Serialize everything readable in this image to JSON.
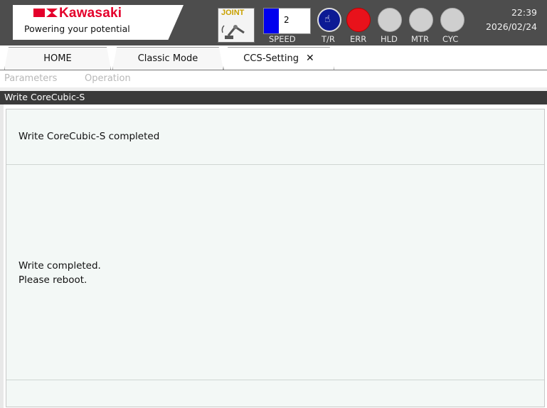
{
  "header": {
    "brand": "Kawasaki",
    "tagline": "Powering your potential",
    "joint_label": "JOINT",
    "speed_value": "2",
    "labels": {
      "speed": "SPEED",
      "tr": "T/R",
      "err": "ERR",
      "hld": "HLD",
      "mtr": "MTR",
      "cyc": "CYC"
    },
    "time": "22:39",
    "date": "2026/02/24",
    "colors": {
      "err": "#e8121b",
      "tr": "#0c1a94",
      "speed": "#0000ee",
      "brand": "#e4002b"
    }
  },
  "tabs": {
    "home": "HOME",
    "classic": "Classic Mode",
    "ccs": "CCS-Setting",
    "close_icon": "✕"
  },
  "menu": {
    "parameters": "Parameters",
    "operation": "Operation"
  },
  "section_title": "Write CoreCubic-S",
  "panel": {
    "headline": "Write CoreCubic-S completed",
    "message_line1": "Write completed.",
    "message_line2": "Please reboot."
  }
}
